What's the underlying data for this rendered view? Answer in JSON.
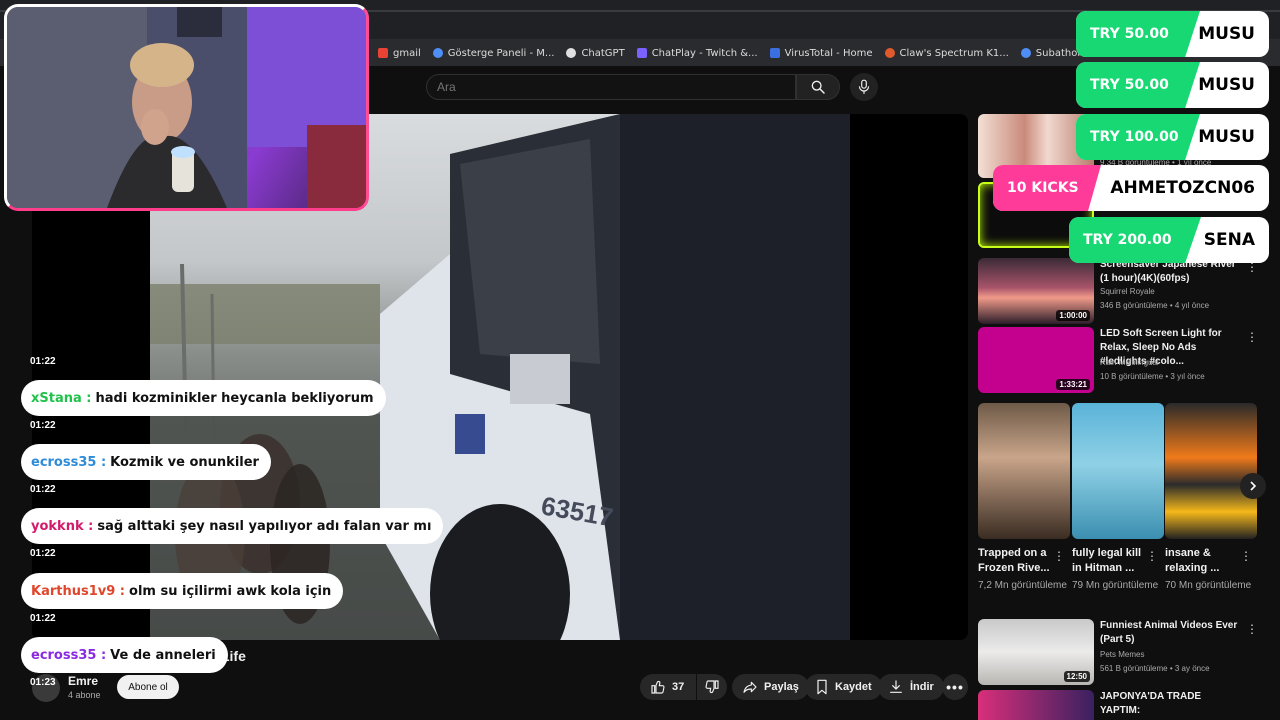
{
  "bookmarks": [
    {
      "label": "gmail",
      "color": "#ea4335"
    },
    {
      "label": "Gösterge Paneli - M...",
      "color": "#4f8ef7"
    },
    {
      "label": "ChatGPT",
      "color": "#e0e0e0"
    },
    {
      "label": "ChatPlay - Twitch &...",
      "color": "#7b61ff"
    },
    {
      "label": "VirusTotal - Home",
      "color": "#3b6fe0"
    },
    {
      "label": "Claw's Spectrum K1...",
      "color": "#e05a2b"
    },
    {
      "label": "Subathon - MissXss...",
      "color": "#4f8ef7"
    }
  ],
  "search": {
    "placeholder": "Ara"
  },
  "video": {
    "title": "ug Life"
  },
  "channel": {
    "name": "Emre",
    "subscribers": "4 abone",
    "subscribe_label": "Abone ol"
  },
  "actions": {
    "likes": "37",
    "share": "Paylaş",
    "save": "Kaydet",
    "download": "İndir"
  },
  "chat": [
    {
      "time": "01:22"
    },
    {
      "time": "01:22",
      "user": "xStana :",
      "user_color": "#21c24b",
      "message": "hadi kozminikler heycanla bekliyorum"
    },
    {
      "time": "01:22",
      "user": "ecross35 :",
      "user_color": "#2e8bd8",
      "message": "Kozmik ve onunkiler"
    },
    {
      "time": "01:22",
      "user": "yokknk :",
      "user_color": "#d21b6b",
      "message": "sağ alttaki şey nasıl yapılıyor adı falan var mı"
    },
    {
      "time": "01:22",
      "user": "Karthus1v9 :",
      "user_color": "#e0462b",
      "message": "olm su içilirmi awk kola için"
    },
    {
      "time": "01:23",
      "user": "ecross35 :",
      "user_color": "#8a2be2",
      "message": "Ve de anneleri"
    }
  ],
  "alerts": [
    {
      "amount": "TRY 50.00",
      "name": "MUSU",
      "color": "#17d873"
    },
    {
      "amount": "TRY 50.00",
      "name": "MUSU",
      "color": "#17d873"
    },
    {
      "amount": "TRY 100.00",
      "name": "MUSU",
      "color": "#17d873"
    },
    {
      "amount": "10 KICKS",
      "name": "AHMETOZCN06",
      "color": "#ff3b9a"
    },
    {
      "amount": "TRY 200.00",
      "name": "SENA",
      "color": "#17d873"
    }
  ],
  "sidebar": {
    "partial_meta": "9,34 B görüntüleme • 1 yıl önce",
    "items": [
      {
        "title": "Screensaver Japanese River (1 hour)(4K)(60fps)",
        "channel": "Squirrel Royale",
        "meta": "346 B görüntüleme • 4 yıl önce",
        "duration": "1:00:00"
      },
      {
        "title": "LED Soft Screen Light for Relax, Sleep No Ads #ledlights #colo...",
        "channel": "Rain Multilingual",
        "meta": "10 B görüntüleme • 3 yıl önce",
        "duration": "1:33:21"
      },
      {
        "title": "Funniest Animal Videos Ever (Part 5)",
        "channel": "Pets Memes",
        "meta": "561 B görüntüleme • 3 ay önce",
        "duration": "12:50"
      },
      {
        "title": "JAPONYA'DA TRADE YAPTIM:"
      }
    ],
    "shorts": [
      {
        "title": "Trapped on a Frozen Rive...",
        "views": "7,2 Mn görüntüleme"
      },
      {
        "title": "fully legal kill in Hitman ...",
        "views": "79 Mn görüntüleme"
      },
      {
        "title": "insane & relaxing ...",
        "views": "70 Mn görüntüleme"
      }
    ]
  }
}
